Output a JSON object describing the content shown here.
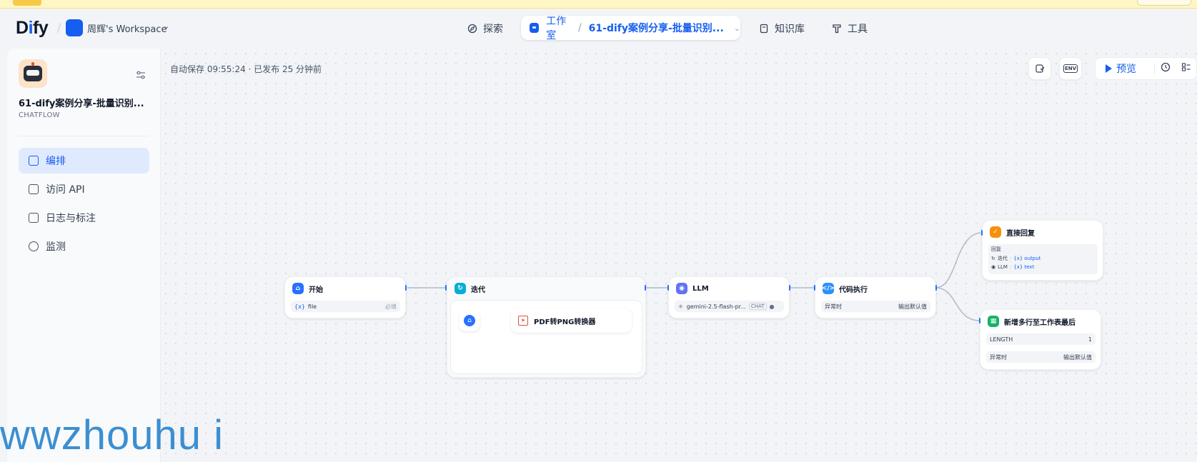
{
  "header": {
    "logo": "Dify",
    "workspace": "周辉's Workspace",
    "nav": {
      "explore": "探索",
      "studio": "工作室",
      "app_name": "61-dify案例分享-批量识别...",
      "knowledge": "知识库",
      "tools": "工具"
    }
  },
  "sidebar": {
    "app_title": "61-dify案例分享-批量识别...",
    "app_type": "CHATFLOW",
    "items": [
      {
        "label": "编排",
        "active": true
      },
      {
        "label": "访问 API",
        "active": false
      },
      {
        "label": "日志与标注",
        "active": false
      },
      {
        "label": "监测",
        "active": false
      }
    ]
  },
  "canvas": {
    "autosave": "自动保存 09:55:24 · 已发布 25 分钟前",
    "preview_label": "预览",
    "env_label": "ENV"
  },
  "nodes": {
    "start": {
      "title": "开始",
      "var": "file",
      "required": "必填"
    },
    "iteration": {
      "title": "迭代",
      "inner": "PDF转PNG转换器"
    },
    "llm": {
      "title": "LLM",
      "model": "gemini-2.5-flash-pr...",
      "mode": "CHAT"
    },
    "code": {
      "title": "代码执行",
      "left": "异常时",
      "right": "输出默认值"
    },
    "answer": {
      "title": "直接回复",
      "label": "回复",
      "row1_src": "迭代",
      "row1_var": "output",
      "row2_src": "LLM",
      "row2_var": "text"
    },
    "append": {
      "title": "新增多行至工作表最后",
      "field": "LENGTH",
      "value": "1",
      "left": "异常时",
      "right": "输出默认值"
    }
  },
  "watermark": "wwzhouhu i",
  "colors": {
    "accent": "#155eef",
    "active_bg": "#e0eaff"
  }
}
